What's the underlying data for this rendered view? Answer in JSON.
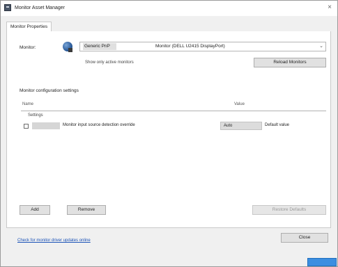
{
  "window": {
    "title": "Monitor Asset Manager",
    "close_glyph": "×"
  },
  "tabs": [
    {
      "label": "Monitor Properties"
    }
  ],
  "monitor": {
    "label": "Monitor:",
    "selected_name": "Generic PnP",
    "detail": "Monitor (DELL U2415 DisplayPort)",
    "subtitle": "Show only active monitors"
  },
  "buttons": {
    "refresh": "Reload Monitors",
    "add": "Add",
    "remove": "Remove",
    "edit_disabled": "Restore Defaults",
    "close": "Close"
  },
  "settings": {
    "section_title": "Monitor configuration settings",
    "columns": {
      "name": "Name",
      "value": "Value"
    },
    "caption": "Settings",
    "rows": [
      {
        "name": "Monitor input source detection override",
        "value": "Auto",
        "description": "Default value"
      }
    ]
  },
  "footer": {
    "link": "Check for monitor driver updates online"
  },
  "icons": {
    "chevron": "⌄",
    "monitor_icon": "globe-monitor-icon"
  }
}
